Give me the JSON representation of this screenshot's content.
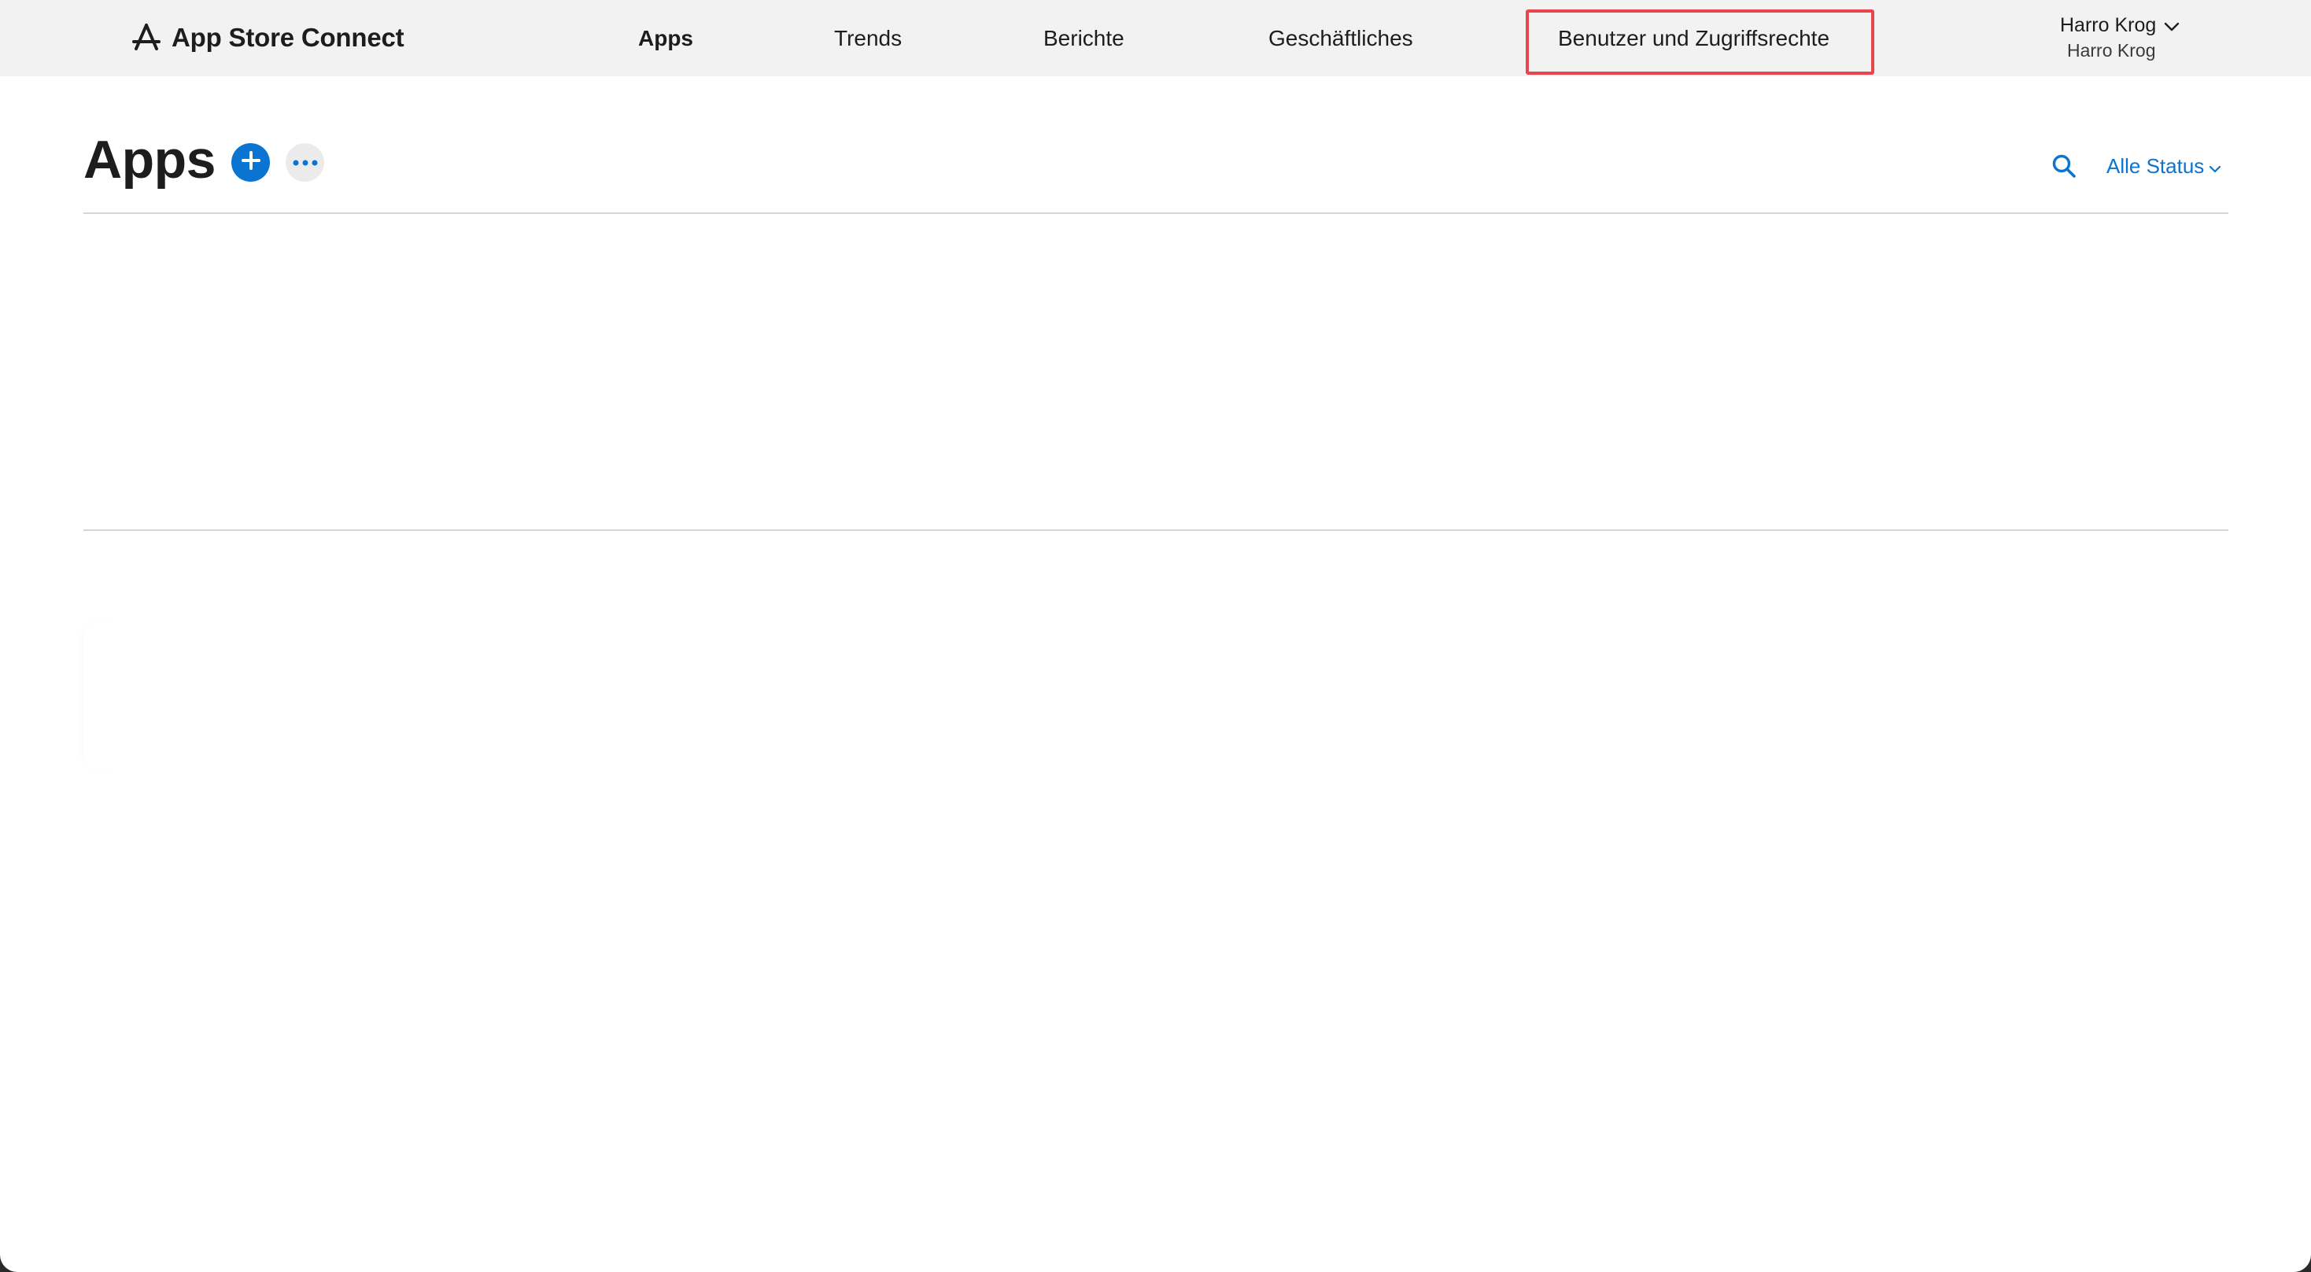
{
  "header": {
    "brand_label": "App Store Connect",
    "brand_icon": "app-store-icon"
  },
  "nav": {
    "items": [
      {
        "label": "Apps",
        "active": true
      },
      {
        "label": "Trends",
        "active": false
      },
      {
        "label": "Berichte",
        "active": false
      },
      {
        "label": "Geschäftliches",
        "active": false
      },
      {
        "label": "Benutzer und Zugriffsrechte",
        "active": false,
        "highlighted": true
      }
    ]
  },
  "account": {
    "name": "Harro Krog",
    "team": "Harro Krog",
    "icon": "chevron-down-icon"
  },
  "page": {
    "title": "Apps",
    "add_icon": "plus-icon",
    "more_icon": "ellipsis-icon",
    "search_icon": "search-icon",
    "status_filter_label": "Alle Status",
    "status_filter_icon": "chevron-down-icon"
  },
  "colors": {
    "accent": "#0a74d0",
    "highlight": "#e8454f",
    "topbar": "#f2f2f2",
    "text": "#1d1d1f"
  }
}
